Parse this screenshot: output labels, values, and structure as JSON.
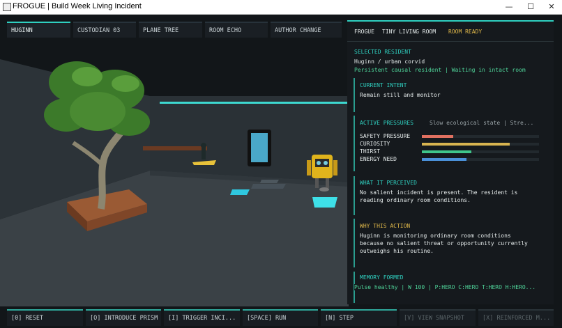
{
  "window": {
    "title": "FROGUE | Build Week Living Incident",
    "minimize": "—",
    "maximize": "☐",
    "close": "✕"
  },
  "tabs": [
    {
      "label": "HUGINN",
      "active": true
    },
    {
      "label": "CUSTODIAN 03",
      "active": false
    },
    {
      "label": "PLANE TREE",
      "active": false
    },
    {
      "label": "ROOM ECHO",
      "active": false
    },
    {
      "label": "AUTHOR CHANGE",
      "active": false
    }
  ],
  "panel": {
    "header": {
      "app": "FROGUE",
      "room": "TINY LIVING ROOM",
      "status": "ROOM READY"
    },
    "selected_resident_label": "SELECTED RESIDENT",
    "resident_name": "Huginn / urban corvid",
    "resident_status": "Persistent causal resident | Waiting in intact room",
    "current_intent_label": "CURRENT INTENT",
    "current_intent": "Remain still and monitor",
    "active_pressures_label": "ACTIVE PRESSURES",
    "active_pressures_summary": "Slow ecological state | Stre...",
    "pressures": [
      {
        "name": "SAFETY PRESSURE",
        "value": 0.27,
        "color": "#e07060"
      },
      {
        "name": "CURIOSITY",
        "value": 0.75,
        "color": "#d8b450"
      },
      {
        "name": "THIRST",
        "value": 0.42,
        "color": "#3fc58a"
      },
      {
        "name": "ENERGY NEED",
        "value": 0.38,
        "color": "#4a90d8"
      }
    ],
    "perceived_label": "WHAT IT PERCEIVED",
    "perceived_lines": [
      "No salient incident is present. The resident is",
      "reading ordinary room conditions."
    ],
    "why_label": "WHY THIS ACTION",
    "why_lines": [
      "Huginn is monitoring ordinary room conditions",
      "because no salient threat or opportunity currently",
      "outweighs his routine."
    ],
    "memory_label": "MEMORY FORMED",
    "pulse": "Pulse healthy | W 100 | P:HERO C:HERO T:HERO H:HERO..."
  },
  "footer": [
    {
      "label": "[0] RESET",
      "enabled": true
    },
    {
      "label": "[O] INTRODUCE PRISM",
      "enabled": true
    },
    {
      "label": "[I] TRIGGER INCI...",
      "enabled": true
    },
    {
      "label": "[SPACE] RUN",
      "enabled": true
    },
    {
      "label": "[N] STEP",
      "enabled": true
    },
    {
      "label": "[V] VIEW SNAPSHOT",
      "enabled": false
    },
    {
      "label": "[X] REINFORCED M...",
      "enabled": false
    }
  ]
}
